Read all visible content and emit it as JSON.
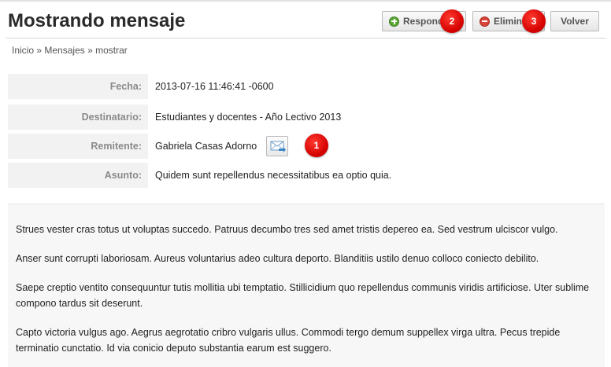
{
  "page": {
    "title": "Mostrando mensaje"
  },
  "toolbar": {
    "reply_label": "Responder",
    "delete_label": "Eliminar",
    "back_label": "Volver"
  },
  "breadcrumb": {
    "items": [
      "Inicio",
      "Mensajes",
      "mostrar"
    ],
    "separator": "»"
  },
  "details": {
    "fecha": {
      "label": "Fecha:",
      "value": "2013-07-16 11:46:41 -0600"
    },
    "destinatario": {
      "label": "Destinatario:",
      "value": "Estudiantes y docentes - Año Lectivo 2013"
    },
    "remitente": {
      "label": "Remitente:",
      "value": "Gabriela Casas Adorno"
    },
    "asunto": {
      "label": "Asunto:",
      "value": "Quidem sunt repellendus necessitatibus ea optio quia."
    }
  },
  "message_body": [
    "Strues vester cras totus ut voluptas succedo. Patruus decumbo tres sed amet tristis depereo ea. Sed vestrum ulciscor vulgo.",
    "Anser sunt corrupti laboriosam. Aureus voluntarius adeo cultura deporto. Blanditiis ustilo denuo colloco coniecto debilito.",
    "Saepe creptio ventito consequuntur tutis mollitia ubi temptatio. Stillicidium quo repellendus communis viridis artificiose. Uter sublime compono tardus sit deserunt.",
    "Capto victoria vulgus ago. Aegrus aegrotatio cribro vulgaris ullus. Commodi tergo demum suppellex virga ultra. Pecus trepide terminatio cunctatio. Id via conicio deputo substantia earum est suggero."
  ],
  "annotations": {
    "badge1": "1",
    "badge2": "2",
    "badge3": "3"
  },
  "colors": {
    "badge": "#d40000",
    "reply_icon": "#5aa632",
    "delete_icon": "#d9443a"
  }
}
